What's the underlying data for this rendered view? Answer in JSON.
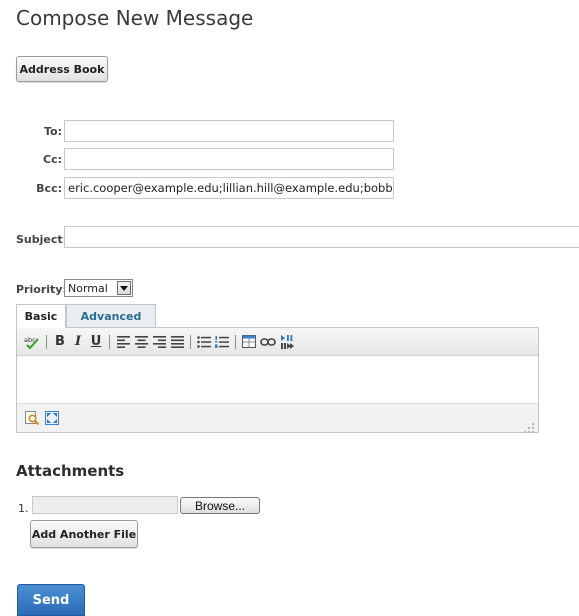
{
  "page": {
    "title": "Compose New Message"
  },
  "buttons": {
    "address_book": "Address Book",
    "add_another_file": "Add Another File",
    "send": "Send"
  },
  "recipients": {
    "to_label": "To:",
    "to_value": "",
    "cc_label": "Cc:",
    "cc_value": "",
    "bcc_label": "Bcc:",
    "bcc_value": "eric.cooper@example.edu;lillian.hill@example.edu;bobby.r"
  },
  "subject": {
    "label": "Subject:",
    "value": ""
  },
  "priority": {
    "label": "Priority:",
    "selected": "Normal"
  },
  "editor": {
    "tabs": [
      {
        "label": "Basic",
        "active": true
      },
      {
        "label": "Advanced",
        "active": false
      }
    ],
    "toolbar": {
      "bold": "B",
      "italic": "I",
      "underline": "U"
    },
    "content": ""
  },
  "attachments": {
    "heading": "Attachments",
    "items": [
      {
        "number": "1.",
        "browse_label": "Browse..."
      }
    ]
  },
  "colors": {
    "send_button": "#2f73bf",
    "tab_link": "#2a6d8f",
    "title_text": "#3a3a3a"
  }
}
